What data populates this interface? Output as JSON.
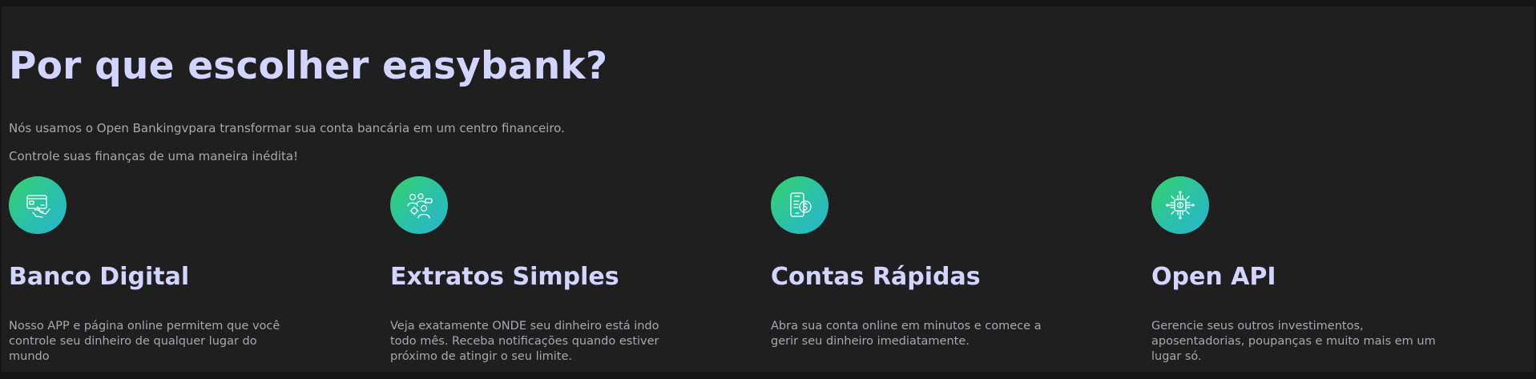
{
  "header": {
    "title": "Por que escolher easybank?",
    "intro_1": "Nós usamos o Open Bankingvpara transformar sua conta bancária em um centro financeiro.",
    "intro_2": "Controle suas finanças de uma maneira inédita!"
  },
  "colors": {
    "background": "#1f1f1f",
    "heading": "#d3d4ff",
    "body_text": "#a8a8ae",
    "icon_gradient_start": "#34d36a",
    "icon_gradient_end": "#27b6d0"
  },
  "features": [
    {
      "icon": "card-hand-icon",
      "title": "Banco Digital",
      "description": "Nosso APP e página online permitem que você controle seu dinheiro de qualquer lugar do mundo"
    },
    {
      "icon": "people-chat-icon",
      "title": "Extratos Simples",
      "description": "Veja exatamente ONDE seu dinheiro está indo todo mês. Receba notificações quando estiver próximo de atingir o seu limite."
    },
    {
      "icon": "phone-coin-icon",
      "title": "Contas Rápidas",
      "description": "Abra sua conta online em minutos e comece a gerir seu dinheiro imediatamente."
    },
    {
      "icon": "chip-circuit-icon",
      "title": "Open API",
      "description": "Gerencie seus outros investimentos, aposentadorias, poupanças e muito mais em um lugar só."
    }
  ]
}
